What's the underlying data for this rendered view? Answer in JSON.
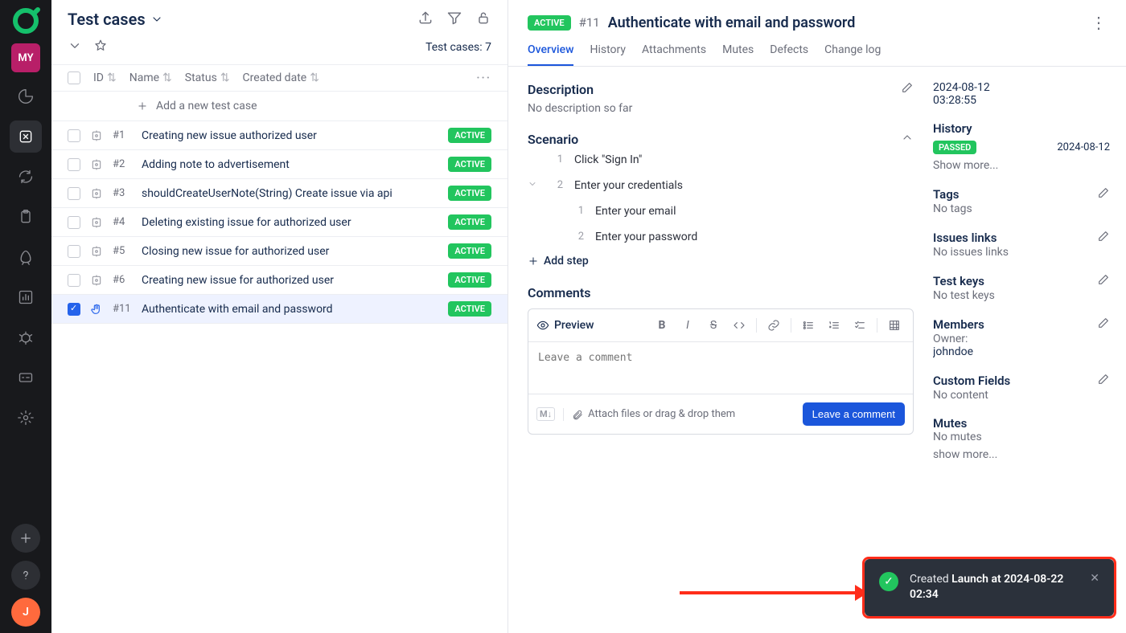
{
  "sidebar": {
    "badge": "MY",
    "avatar": "J"
  },
  "leftPane": {
    "title": "Test cases",
    "count": "Test cases: 7",
    "columns": {
      "id": "ID",
      "name": "Name",
      "status": "Status",
      "created": "Created date"
    },
    "addRow": "Add a new test case",
    "rows": [
      {
        "id": "#1",
        "name": "Creating new issue authorized user",
        "status": "ACTIVE",
        "type": "auto"
      },
      {
        "id": "#2",
        "name": "Adding note to advertisement",
        "status": "ACTIVE",
        "type": "auto"
      },
      {
        "id": "#3",
        "name": "shouldCreateUserNote(String) Create issue via api",
        "status": "ACTIVE",
        "type": "auto"
      },
      {
        "id": "#4",
        "name": "Deleting existing issue for authorized user",
        "status": "ACTIVE",
        "type": "auto"
      },
      {
        "id": "#5",
        "name": "Closing new issue for authorized user",
        "status": "ACTIVE",
        "type": "auto"
      },
      {
        "id": "#6",
        "name": "Creating new issue for authorized user",
        "status": "ACTIVE",
        "type": "auto"
      },
      {
        "id": "#11",
        "name": "Authenticate with email and password",
        "status": "ACTIVE",
        "type": "manual",
        "selected": true
      }
    ]
  },
  "detail": {
    "active": "ACTIVE",
    "id": "#11",
    "title": "Authenticate with email and password",
    "tabs": [
      "Overview",
      "History",
      "Attachments",
      "Mutes",
      "Defects",
      "Change log"
    ],
    "description": {
      "label": "Description",
      "text": "No description so far"
    },
    "scenario": {
      "label": "Scenario",
      "steps": [
        {
          "n": "1",
          "text": "Click \"Sign In\""
        },
        {
          "n": "2",
          "text": "Enter your credentials",
          "sub": [
            {
              "n": "1",
              "text": "Enter your email"
            },
            {
              "n": "2",
              "text": "Enter your password"
            }
          ]
        }
      ],
      "addStep": "Add step"
    },
    "comments": {
      "label": "Comments",
      "preview": "Preview",
      "placeholder": "Leave a comment",
      "attach": "Attach files or drag & drop them",
      "button": "Leave a comment"
    }
  },
  "side": {
    "timestamp1": "2024-08-12",
    "timestamp2": "03:28:55",
    "history": {
      "label": "History",
      "status": "PASSED",
      "date": "2024-08-12",
      "more": "Show more..."
    },
    "tags": {
      "label": "Tags",
      "empty": "No tags"
    },
    "issues": {
      "label": "Issues links",
      "empty": "No issues links"
    },
    "testkeys": {
      "label": "Test keys",
      "empty": "No test keys"
    },
    "members": {
      "label": "Members",
      "owner": "Owner:",
      "name": "johndoe"
    },
    "custom": {
      "label": "Custom Fields",
      "empty": "No content"
    },
    "mutes": {
      "label": "Mutes",
      "empty": "No mutes",
      "more": "show more..."
    }
  },
  "toast": {
    "prefix": "Created ",
    "bold": "Launch at 2024-08-22 02:34"
  }
}
